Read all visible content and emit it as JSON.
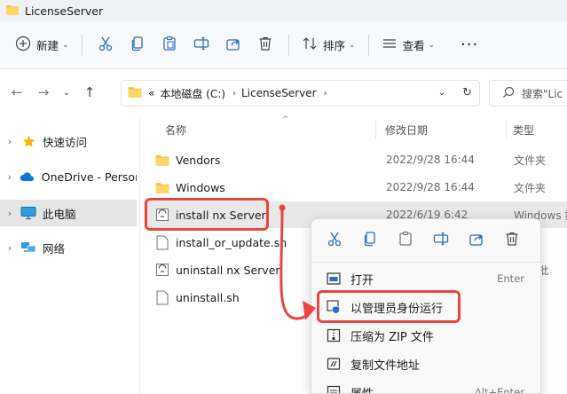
{
  "window": {
    "title": "LicenseServer"
  },
  "toolbar": {
    "new_label": "新建",
    "sort_label": "排序",
    "view_label": "查看",
    "more_label": "···"
  },
  "address": {
    "overflow": "«",
    "parts": [
      "本地磁盘 (C:)",
      "LicenseServer"
    ],
    "search_placeholder": "搜索\"Lic"
  },
  "sidebar": {
    "items": [
      {
        "label": "快速访问",
        "icon": "star-icon"
      },
      {
        "label": "OneDrive - Persor",
        "icon": "onedrive-icon"
      },
      {
        "label": "此电脑",
        "icon": "monitor-icon"
      },
      {
        "label": "网络",
        "icon": "network-icon"
      }
    ]
  },
  "columns": {
    "name": "名称",
    "date": "修改日期",
    "type": "类型"
  },
  "files": [
    {
      "name": "Vendors",
      "date": "2022/9/28 16:44",
      "type": "文件夹",
      "icon": "folder-icon"
    },
    {
      "name": "Windows",
      "date": "2022/9/28 16:44",
      "type": "文件夹",
      "icon": "folder-icon"
    },
    {
      "name": "install nx Server",
      "date": "2022/6/19 6:42",
      "type": "Windows 批",
      "icon": "batch-file-icon"
    },
    {
      "name": "install_or_update.sh",
      "date": "",
      "type": "",
      "icon": "file-icon"
    },
    {
      "name": "uninstall nx Server",
      "date": "",
      "type": "ows 批",
      "icon": "batch-file-icon"
    },
    {
      "name": "uninstall.sh",
      "date": "",
      "type": "",
      "icon": "file-icon"
    }
  ],
  "context_menu": {
    "items": [
      {
        "label": "打开",
        "shortcut": "Enter",
        "icon": "open-icon"
      },
      {
        "label": "以管理员身份运行",
        "shortcut": "",
        "icon": "shield-icon"
      },
      {
        "label": "压缩为 ZIP 文件",
        "shortcut": "",
        "icon": "zip-icon"
      },
      {
        "label": "复制文件地址",
        "shortcut": "",
        "icon": "copy-path-icon"
      },
      {
        "label": "属性",
        "shortcut": "Alt+Enter",
        "icon": "properties-icon"
      }
    ]
  },
  "colors": {
    "annotation": "#e8463f",
    "accent": "#0067c0",
    "folder": "#f6c342"
  }
}
